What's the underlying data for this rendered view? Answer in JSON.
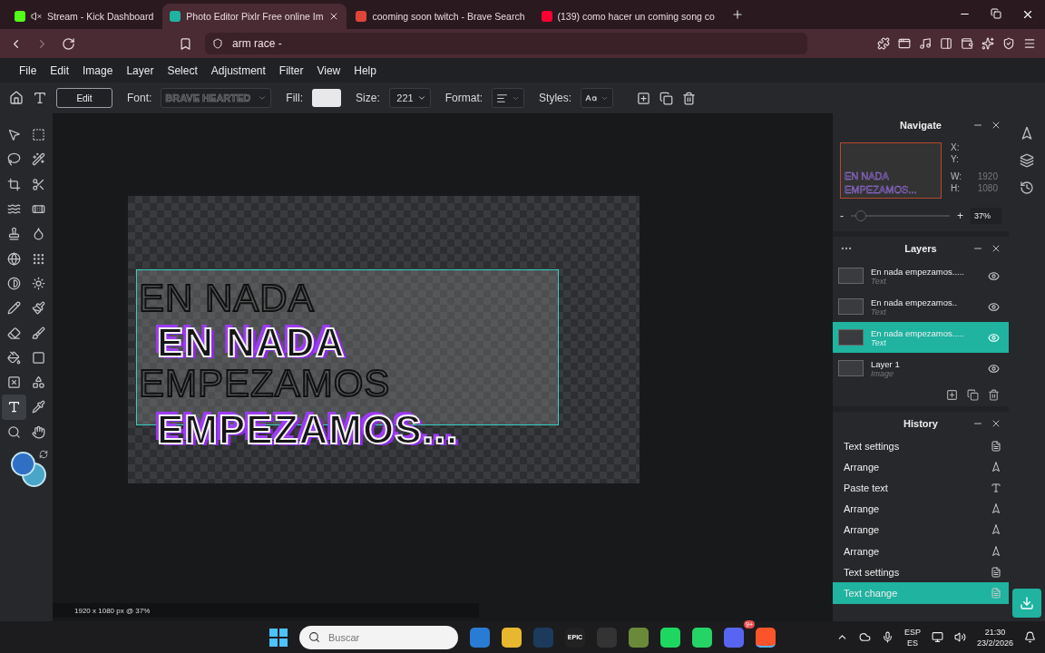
{
  "browser": {
    "tabs": [
      {
        "title": "Stream - Kick Dashboard",
        "selected": false,
        "muted": true,
        "color": "#53fc18"
      },
      {
        "title": "Photo Editor Pixlr Free online Im",
        "selected": true,
        "muted": false,
        "color": "#1fb3a0"
      },
      {
        "title": "cooming soon twitch - Brave Search",
        "selected": false,
        "muted": false,
        "color": "#e0453a"
      },
      {
        "title": "(139) como hacer un coming song co",
        "selected": false,
        "muted": false,
        "color": "#ff0033"
      }
    ],
    "address": "arm race -"
  },
  "menu": [
    "File",
    "Edit",
    "Image",
    "Layer",
    "Select",
    "Adjustment",
    "Filter",
    "View",
    "Help"
  ],
  "options": {
    "edit_button": "Edit",
    "font_label": "Font:",
    "font_value": "BRAVE HEARTED",
    "fill_label": "Fill:",
    "size_label": "Size:",
    "size_value": "221",
    "format_label": "Format:",
    "styles_label": "Styles:"
  },
  "tools": [
    {
      "kind": "arrange",
      "selected": false
    },
    {
      "kind": "marquee",
      "selected": false
    },
    {
      "kind": "lasso",
      "selected": false
    },
    {
      "kind": "wand",
      "selected": false
    },
    {
      "kind": "crop",
      "selected": false
    },
    {
      "kind": "cutout",
      "selected": false
    },
    {
      "kind": "liquify",
      "selected": false
    },
    {
      "kind": "heal",
      "selected": false
    },
    {
      "kind": "clone",
      "selected": false
    },
    {
      "kind": "blur",
      "selected": false
    },
    {
      "kind": "sponge",
      "selected": false
    },
    {
      "kind": "dots",
      "selected": false
    },
    {
      "kind": "dodge",
      "selected": false
    },
    {
      "kind": "sun",
      "selected": false
    },
    {
      "kind": "pencil",
      "selected": false
    },
    {
      "kind": "brush",
      "selected": false
    },
    {
      "kind": "eraser",
      "selected": false
    },
    {
      "kind": "replace",
      "selected": false
    },
    {
      "kind": "fill",
      "selected": false
    },
    {
      "kind": "gradient",
      "selected": false
    },
    {
      "kind": "placeholder",
      "selected": false
    },
    {
      "kind": "shape",
      "selected": false
    },
    {
      "kind": "text",
      "selected": true
    },
    {
      "kind": "picker",
      "selected": false
    },
    {
      "kind": "zoom",
      "selected": false
    },
    {
      "kind": "hand",
      "selected": false
    }
  ],
  "swatches": [
    {
      "color": "#2f6fc4"
    },
    {
      "color": "#4aa6c8"
    }
  ],
  "canvas": {
    "outline_lines": [
      "EN NADA",
      "EMPEZAMOS"
    ],
    "shadow_lines": [
      "EN NADA",
      "EMPEZAMOS..."
    ],
    "status": "1920 x 1080 px @ 37%"
  },
  "navigate": {
    "title": "Navigate",
    "preview_lines": [
      "EN NADA",
      "EMPEZAMOS..."
    ],
    "x_label": "X:",
    "y_label": "Y:",
    "w_label": "W:",
    "w_value": "1920",
    "h_label": "H:",
    "h_value": "1080",
    "minus": "-",
    "plus": "+",
    "level": 0.1,
    "zoom": "37%"
  },
  "layers": {
    "title": "Layers",
    "items": [
      {
        "name": "En nada empezamos.....",
        "type": "Text",
        "selected": false,
        "visible": true
      },
      {
        "name": "En nada empezamos..",
        "type": "Text",
        "selected": false,
        "visible": true
      },
      {
        "name": "En nada empezamos.....",
        "type": "Text",
        "selected": true,
        "visible": true
      },
      {
        "name": "Layer 1",
        "type": "Image",
        "selected": false,
        "visible": true
      }
    ]
  },
  "history": {
    "title": "History",
    "items": [
      {
        "label": "Text settings",
        "kind": "settings",
        "selected": false
      },
      {
        "label": "Arrange",
        "kind": "arrange",
        "selected": false
      },
      {
        "label": "Paste text",
        "kind": "text",
        "selected": false
      },
      {
        "label": "Arrange",
        "kind": "arrange",
        "selected": false
      },
      {
        "label": "Arrange",
        "kind": "arrange",
        "selected": false
      },
      {
        "label": "Arrange",
        "kind": "arrange",
        "selected": false
      },
      {
        "label": "Text settings",
        "kind": "settings",
        "selected": false
      },
      {
        "label": "Text change",
        "kind": "settings",
        "selected": true
      }
    ]
  },
  "taskbar": {
    "search_placeholder": "Buscar",
    "apps": [
      {
        "kind": "photos",
        "active": false
      },
      {
        "kind": "folder",
        "active": false
      },
      {
        "kind": "steam",
        "active": false
      },
      {
        "kind": "epic",
        "active": false
      },
      {
        "kind": "obs",
        "active": false
      },
      {
        "kind": "minecraft",
        "active": false
      },
      {
        "kind": "spotify",
        "active": false
      },
      {
        "kind": "whatsapp",
        "active": false
      },
      {
        "kind": "discord",
        "active": false
      },
      {
        "kind": "brave",
        "active": true
      }
    ],
    "epic_text": "EPIC",
    "discord_badge": "9+",
    "lang_top": "ESP",
    "lang_bottom": "ES",
    "time": "21:30",
    "date": "23/2/2026"
  }
}
